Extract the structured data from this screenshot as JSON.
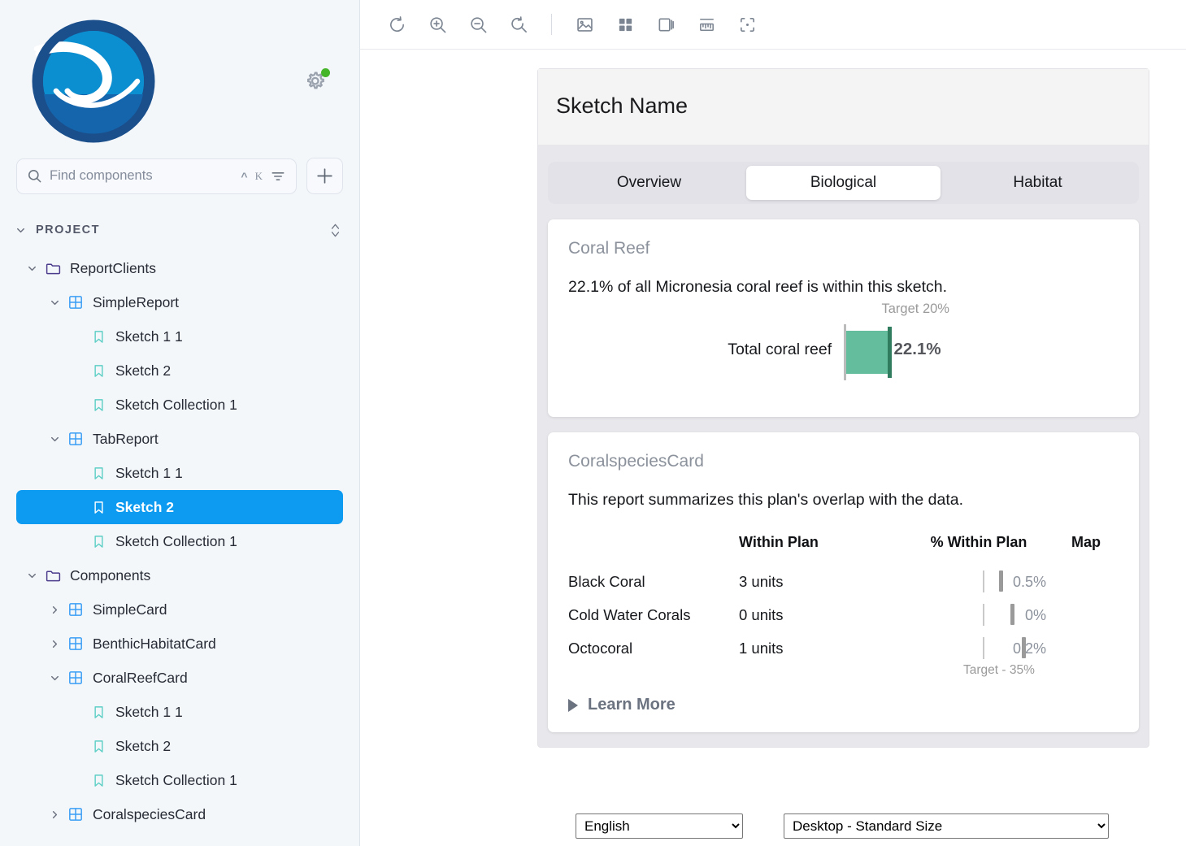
{
  "sidebar": {
    "logo": {
      "name": "seasketch-wave-logo"
    },
    "settings": {
      "icon": "gear-icon",
      "status": "online"
    },
    "search": {
      "placeholder": "Find components",
      "value": "",
      "shortcut_mod": "^",
      "shortcut_key": "K",
      "filter_icon": "filter-icon"
    },
    "add_button": {
      "label": "+",
      "icon": "plus-icon"
    },
    "section_title": "PROJECT",
    "sort_icon": "sort-updown-icon",
    "tree": [
      {
        "label": "ReportClients",
        "icon": "folder-icon",
        "depth": 1,
        "expanded": true,
        "selected": false,
        "has_toggle": true
      },
      {
        "label": "SimpleReport",
        "icon": "component-icon",
        "depth": 2,
        "expanded": true,
        "selected": false,
        "has_toggle": true
      },
      {
        "label": "Sketch 1 1",
        "icon": "bookmark-icon",
        "depth": 3,
        "expanded": null,
        "selected": false,
        "has_toggle": false
      },
      {
        "label": "Sketch 2",
        "icon": "bookmark-icon",
        "depth": 3,
        "expanded": null,
        "selected": false,
        "has_toggle": false
      },
      {
        "label": "Sketch Collection 1",
        "icon": "bookmark-icon",
        "depth": 3,
        "expanded": null,
        "selected": false,
        "has_toggle": false
      },
      {
        "label": "TabReport",
        "icon": "component-icon",
        "depth": 2,
        "expanded": true,
        "selected": false,
        "has_toggle": true
      },
      {
        "label": "Sketch 1 1",
        "icon": "bookmark-icon",
        "depth": 3,
        "expanded": null,
        "selected": false,
        "has_toggle": false
      },
      {
        "label": "Sketch 2",
        "icon": "bookmark-icon",
        "depth": 3,
        "expanded": null,
        "selected": true,
        "has_toggle": false
      },
      {
        "label": "Sketch Collection 1",
        "icon": "bookmark-icon",
        "depth": 3,
        "expanded": null,
        "selected": false,
        "has_toggle": false
      },
      {
        "label": "Components",
        "icon": "folder-icon",
        "depth": 1,
        "expanded": true,
        "selected": false,
        "has_toggle": true
      },
      {
        "label": "SimpleCard",
        "icon": "component-icon",
        "depth": 2,
        "expanded": false,
        "selected": false,
        "has_toggle": true
      },
      {
        "label": "BenthicHabitatCard",
        "icon": "component-icon",
        "depth": 2,
        "expanded": false,
        "selected": false,
        "has_toggle": true
      },
      {
        "label": "CoralReefCard",
        "icon": "component-icon",
        "depth": 2,
        "expanded": true,
        "selected": false,
        "has_toggle": true
      },
      {
        "label": "Sketch 1 1",
        "icon": "bookmark-icon",
        "depth": 3,
        "expanded": null,
        "selected": false,
        "has_toggle": false
      },
      {
        "label": "Sketch 2",
        "icon": "bookmark-icon",
        "depth": 3,
        "expanded": null,
        "selected": false,
        "has_toggle": false
      },
      {
        "label": "Sketch Collection 1",
        "icon": "bookmark-icon",
        "depth": 3,
        "expanded": null,
        "selected": false,
        "has_toggle": false
      },
      {
        "label": "CoralspeciesCard",
        "icon": "component-icon",
        "depth": 2,
        "expanded": false,
        "selected": false,
        "has_toggle": true
      }
    ]
  },
  "toolbar": {
    "buttons": [
      {
        "name": "refresh-icon",
        "title": "Refresh"
      },
      {
        "name": "zoom-in-icon",
        "title": "Zoom In"
      },
      {
        "name": "zoom-out-icon",
        "title": "Zoom Out"
      },
      {
        "name": "zoom-reset-icon",
        "title": "Reset Zoom"
      },
      {
        "name": "image-icon",
        "title": "Image"
      },
      {
        "name": "grid-icon",
        "title": "Grid"
      },
      {
        "name": "layers-icon",
        "title": "Layers"
      },
      {
        "name": "ruler-icon",
        "title": "Ruler"
      },
      {
        "name": "selection-icon",
        "title": "Selection"
      }
    ]
  },
  "report": {
    "sketch_title": "Sketch Name",
    "tabs": [
      {
        "label": "Overview",
        "active": false
      },
      {
        "label": "Biological",
        "active": true
      },
      {
        "label": "Habitat",
        "active": false
      }
    ],
    "coral_reef_card": {
      "title": "Coral Reef",
      "summary": "22.1% of all Micronesia coral reef is within this sketch."
    },
    "coral_species_card": {
      "title": "CoralspeciesCard",
      "summary": "This report summarizes this plan's overlap with the data.",
      "columns": [
        "",
        "Within Plan",
        "% Within Plan",
        "Map"
      ],
      "rows": [
        {
          "name": "Black Coral",
          "within_plan": "3 units",
          "pct_within_plan": "0.5%",
          "map": ""
        },
        {
          "name": "Cold Water Corals",
          "within_plan": "0 units",
          "pct_within_plan": "0%",
          "map": ""
        },
        {
          "name": "Octocoral",
          "within_plan": "1 units",
          "pct_within_plan": "0.2%",
          "map": ""
        }
      ],
      "target_caption": "Target - 35%",
      "learn_more": "Learn More"
    }
  },
  "footer": {
    "language": {
      "selected": "English",
      "options": [
        "English"
      ]
    },
    "viewport": {
      "selected": "Desktop - Standard Size",
      "options": [
        "Desktop - Standard Size"
      ]
    }
  },
  "colors": {
    "accent_blue": "#0c9bf0",
    "bar_green": "#64be9e",
    "target_green": "#2f7d5e",
    "axis_gray": "#bcbcbc",
    "folder": "#4a3b8c",
    "component": "#3b9ef5",
    "bookmark": "#5dcfc5",
    "status_dot": "#45b52a"
  },
  "chart_data": [
    {
      "type": "bar",
      "orientation": "horizontal",
      "title": "Coral Reef",
      "categories": [
        "Total coral reef"
      ],
      "values": [
        22.1
      ],
      "value_labels": [
        "22.1%"
      ],
      "target": 20,
      "target_label": "Target 20%",
      "unit": "%",
      "xlim": [
        0,
        100
      ],
      "grid": false,
      "legend": false,
      "series": [
        {
          "name": "Total coral reef",
          "values": [
            22.1
          ]
        }
      ]
    },
    {
      "type": "bar",
      "orientation": "horizontal",
      "title": "CoralspeciesCard",
      "categories": [
        "Black Coral",
        "Cold Water Corals",
        "Octocoral"
      ],
      "values": [
        0.5,
        0,
        0.2
      ],
      "value_labels": [
        "0.5%",
        "0%",
        "0.2%"
      ],
      "counts": [
        "3 units",
        "0 units",
        "1 units"
      ],
      "target": 35,
      "target_label": "Target - 35%",
      "unit": "%",
      "xlim": [
        0,
        100
      ],
      "grid": false,
      "legend": false
    }
  ]
}
